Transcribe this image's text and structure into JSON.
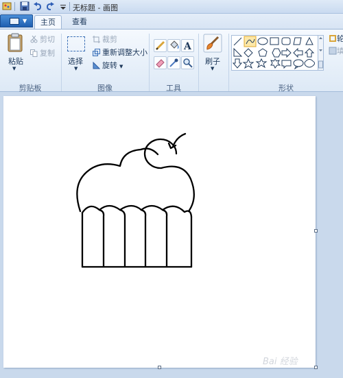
{
  "window": {
    "title": "无标题 - 画图"
  },
  "quick_access": [
    "paint-app-icon",
    "save-icon",
    "undo-icon",
    "redo-icon",
    "customize-dropdown-icon"
  ],
  "tabs": [
    {
      "label": "主页",
      "active": true
    },
    {
      "label": "查看",
      "active": false
    }
  ],
  "ribbon": {
    "clipboard": {
      "paste": "粘贴",
      "cut": "剪切",
      "copy": "复制",
      "group": "剪贴板"
    },
    "image": {
      "select": "选择",
      "crop": "裁剪",
      "resize": "重新调整大小",
      "rotate": "旋转",
      "group": "图像"
    },
    "tools": {
      "group": "工具",
      "items": [
        "pencil-icon",
        "fill-icon",
        "text-icon",
        "eraser-icon",
        "color-picker-icon",
        "magnifier-icon"
      ]
    },
    "brushes": {
      "label": "刷子"
    },
    "shapes": {
      "group": "形状",
      "cut_label_1": "轮",
      "cut_label_2": "填"
    }
  },
  "watermark": "Bai 经验",
  "colors": {
    "accent": "#1f5fb0",
    "ribbon": "#dde9f6",
    "workspace": "#c9d9ec"
  }
}
